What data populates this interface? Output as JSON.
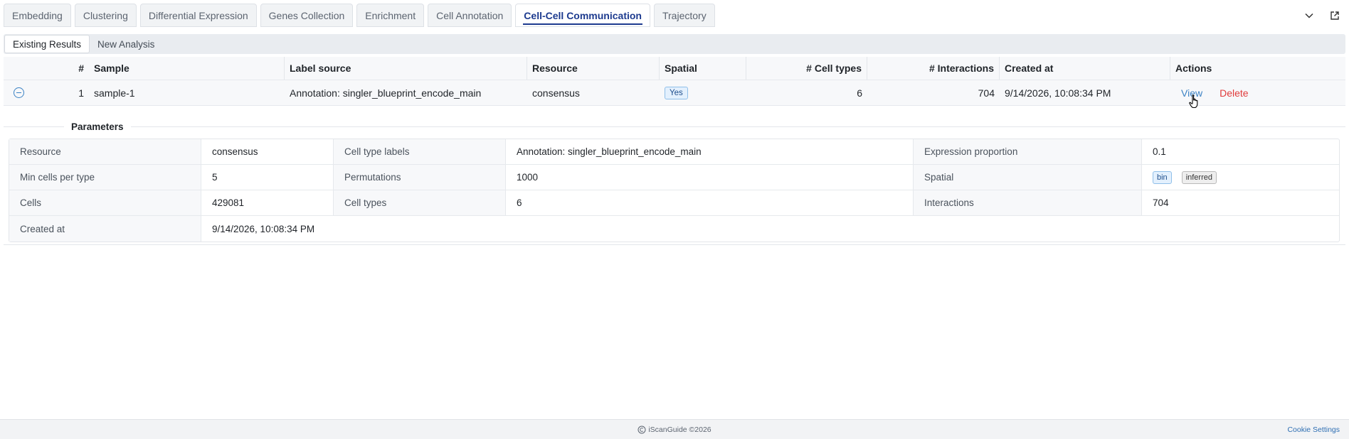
{
  "tabs": [
    "Embedding",
    "Clustering",
    "Differential Expression",
    "Genes Collection",
    "Enrichment",
    "Cell Annotation",
    "Cell-Cell Communication",
    "Trajectory"
  ],
  "active_tab": "Cell-Cell Communication",
  "subtabs": {
    "existing": "Existing Results",
    "new": "New Analysis"
  },
  "results": {
    "headers": {
      "num": "#",
      "sample": "Sample",
      "label_source": "Label source",
      "resource": "Resource",
      "spatial": "Spatial",
      "cell_types": "# Cell types",
      "interactions": "# Interactions",
      "created_at": "Created at",
      "actions": "Actions"
    },
    "row": {
      "num": "1",
      "sample": "sample-1",
      "label_source": "Annotation: singler_blueprint_encode_main",
      "resource": "consensus",
      "spatial": "Yes",
      "cell_types": "6",
      "interactions": "704",
      "created_at": "9/14/2026, 10:08:34 PM",
      "view": "View",
      "delete": "Delete"
    }
  },
  "parameters": {
    "title": "Parameters",
    "resource_k": "Resource",
    "resource_v": "consensus",
    "labels_k": "Cell type labels",
    "labels_v": "Annotation: singler_blueprint_encode_main",
    "expr_k": "Expression proportion",
    "expr_v": "0.1",
    "mincells_k": "Min cells per type",
    "mincells_v": "5",
    "perm_k": "Permutations",
    "perm_v": "1000",
    "spatial_k": "Spatial",
    "spatial_tag1": "bin",
    "spatial_tag2": "inferred",
    "cells_k": "Cells",
    "cells_v": "429081",
    "celltypes_k": "Cell types",
    "celltypes_v": "6",
    "inter_k": "Interactions",
    "inter_v": "704",
    "created_k": "Created at",
    "created_v": "9/14/2026, 10:08:34 PM"
  },
  "footer": {
    "copyright": "iScanGuide ©2026",
    "cookie": "Cookie Settings"
  },
  "icons": {
    "collapse": "collapse-row-icon",
    "chevron": "chevron-down-icon",
    "open": "open-external-icon",
    "cursor": "hand-pointer-icon"
  },
  "colors": {
    "accent": "#1d3b8f",
    "link": "#3b82c4",
    "danger": "#e03b3b"
  }
}
